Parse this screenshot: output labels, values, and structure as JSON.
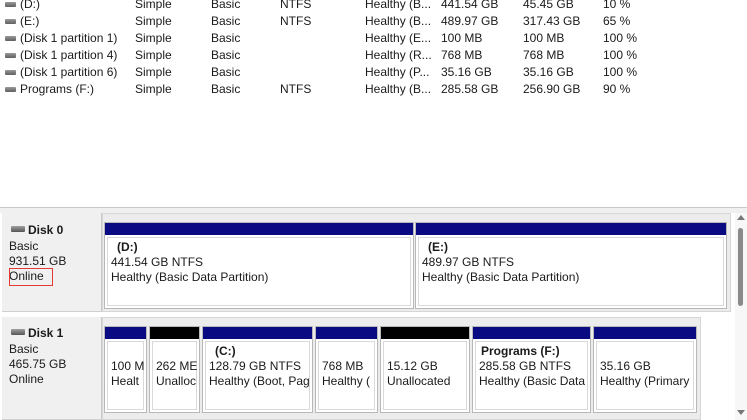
{
  "volumes": [
    {
      "name": "(D:)",
      "layout": "Simple",
      "type": "Basic",
      "fs": "NTFS",
      "status": "Healthy (B...",
      "capacity": "441.54 GB",
      "free": "45.45 GB",
      "pct": "10 %"
    },
    {
      "name": "(E:)",
      "layout": "Simple",
      "type": "Basic",
      "fs": "NTFS",
      "status": "Healthy (B...",
      "capacity": "489.97 GB",
      "free": "317.43 GB",
      "pct": "65 %"
    },
    {
      "name": "(Disk 1 partition 1)",
      "layout": "Simple",
      "type": "Basic",
      "fs": "",
      "status": "Healthy (E...",
      "capacity": "100 MB",
      "free": "100 MB",
      "pct": "100 %"
    },
    {
      "name": "(Disk 1 partition 4)",
      "layout": "Simple",
      "type": "Basic",
      "fs": "",
      "status": "Healthy (R...",
      "capacity": "768 MB",
      "free": "768 MB",
      "pct": "100 %"
    },
    {
      "name": "(Disk 1 partition 6)",
      "layout": "Simple",
      "type": "Basic",
      "fs": "",
      "status": "Healthy (P...",
      "capacity": "35.16 GB",
      "free": "35.16 GB",
      "pct": "100 %"
    },
    {
      "name": "Programs (F:)",
      "layout": "Simple",
      "type": "Basic",
      "fs": "NTFS",
      "status": "Healthy (B...",
      "capacity": "285.58 GB",
      "free": "256.90 GB",
      "pct": "90 %"
    }
  ],
  "disk0": {
    "title": "Disk 0",
    "type": "Basic",
    "size": "931.51 GB",
    "state": "Online",
    "partitions": [
      {
        "name": "(D:)",
        "size_fs": "441.54 GB NTFS",
        "status": "Healthy (Basic Data Partition)",
        "unallocated": false
      },
      {
        "name": "(E:)",
        "size_fs": "489.97 GB NTFS",
        "status": "Healthy (Basic Data Partition)",
        "unallocated": false
      }
    ]
  },
  "disk1": {
    "title": "Disk 1",
    "type": "Basic",
    "size": "465.75 GB",
    "state": "Online",
    "partitions": [
      {
        "name": "",
        "size_fs": "100 M",
        "status": "Healt",
        "unallocated": false
      },
      {
        "name": "",
        "size_fs": "262 ME",
        "status": "Unalloc",
        "unallocated": true
      },
      {
        "name": "(C:)",
        "size_fs": "128.79 GB NTFS",
        "status": "Healthy (Boot, Pag",
        "unallocated": false
      },
      {
        "name": "",
        "size_fs": "768 MB",
        "status": "Healthy (",
        "unallocated": false
      },
      {
        "name": "",
        "size_fs": "15.12 GB",
        "status": "Unallocated",
        "unallocated": true
      },
      {
        "name": "Programs  (F:)",
        "size_fs": "285.58 GB NTFS",
        "status": "Healthy (Basic Data",
        "unallocated": false
      },
      {
        "name": "",
        "size_fs": "35.16 GB",
        "status": "Healthy (Primary",
        "unallocated": false
      }
    ]
  },
  "colors": {
    "primary_bar": "#0a0a82",
    "unallocated_bar": "#000000",
    "highlight_border": "#e53935"
  }
}
